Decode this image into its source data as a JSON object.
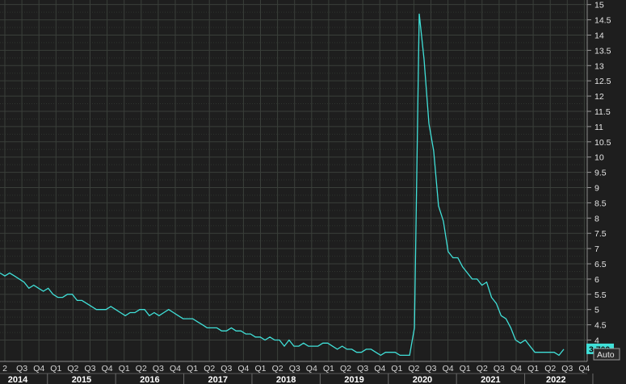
{
  "chart_data": {
    "type": "line",
    "title": "",
    "xlabel": "",
    "ylabel": "",
    "ylim": [
      3.4,
      15
    ],
    "y_ticks": [
      "4",
      "4.5",
      "5",
      "5.5",
      "6",
      "6.5",
      "7",
      "7.5",
      "8",
      "8.5",
      "9",
      "9.5",
      "10",
      "10.5",
      "11",
      "11.5",
      "12",
      "12.5",
      "13",
      "13.5",
      "14",
      "14.5",
      "15"
    ],
    "quarter_labels": [
      "2",
      "Q3",
      "Q4",
      "Q1",
      "Q2",
      "Q3",
      "Q4",
      "Q1",
      "Q2",
      "Q3",
      "Q4",
      "Q1",
      "Q2",
      "Q3",
      "Q4",
      "Q1",
      "Q2",
      "Q3",
      "Q4",
      "Q1",
      "Q2",
      "Q3",
      "Q4",
      "Q1",
      "Q2",
      "Q3",
      "Q4",
      "Q1",
      "Q2",
      "Q3",
      "Q4",
      "Q1",
      "Q2",
      "Q3",
      "Q4"
    ],
    "year_labels": [
      "2014",
      "2015",
      "2016",
      "2017",
      "2018",
      "2019",
      "2020",
      "2021",
      "2022"
    ],
    "last_value_label": "3.700",
    "auto_label": "Auto",
    "line_color": "#40e0d8",
    "grid": true,
    "series": [
      {
        "values": [
          6.2,
          6.1,
          6.2,
          6.1,
          6.0,
          5.9,
          5.7,
          5.8,
          5.7,
          5.6,
          5.7,
          5.5,
          5.4,
          5.4,
          5.5,
          5.5,
          5.3,
          5.3,
          5.2,
          5.1,
          5.0,
          5.0,
          5.0,
          5.1,
          5.0,
          4.9,
          4.8,
          4.9,
          4.9,
          5.0,
          5.0,
          4.8,
          4.9,
          4.8,
          4.9,
          5.0,
          4.9,
          4.8,
          4.7,
          4.7,
          4.7,
          4.6,
          4.5,
          4.4,
          4.4,
          4.4,
          4.3,
          4.3,
          4.4,
          4.3,
          4.3,
          4.2,
          4.2,
          4.1,
          4.1,
          4.0,
          4.1,
          4.0,
          4.0,
          3.8,
          4.0,
          3.8,
          3.8,
          3.9,
          3.8,
          3.8,
          3.8,
          3.9,
          3.9,
          3.8,
          3.7,
          3.8,
          3.7,
          3.7,
          3.6,
          3.6,
          3.7,
          3.7,
          3.6,
          3.5,
          3.6,
          3.6,
          3.6,
          3.5,
          3.5,
          3.5,
          4.4,
          14.7,
          13.2,
          11.1,
          10.2,
          8.4,
          7.9,
          6.9,
          6.7,
          6.7,
          6.4,
          6.2,
          6.0,
          6.0,
          5.8,
          5.9,
          5.4,
          5.2,
          4.8,
          4.7,
          4.4,
          4.0,
          3.9,
          4.0,
          3.8,
          3.6,
          3.6,
          3.6,
          3.6,
          3.6,
          3.5,
          3.7
        ]
      }
    ]
  }
}
